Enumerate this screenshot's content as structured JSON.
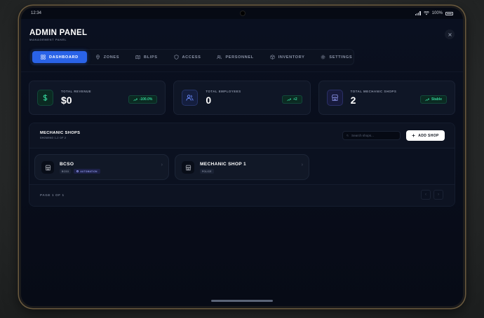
{
  "status_bar": {
    "time": "12:34",
    "battery": "100%"
  },
  "header": {
    "title": "ADMIN PANEL",
    "subtitle": "MANAGEMENT PANEL"
  },
  "nav": {
    "tabs": [
      {
        "label": "DASHBOARD",
        "icon": "dashboard-icon",
        "active": true
      },
      {
        "label": "ZONES",
        "icon": "map-pin-icon"
      },
      {
        "label": "BLIPS",
        "icon": "map-icon"
      },
      {
        "label": "ACCESS",
        "icon": "shield-icon"
      },
      {
        "label": "PERSONNEL",
        "icon": "users-icon"
      },
      {
        "label": "INVENTORY",
        "icon": "box-icon"
      },
      {
        "label": "SETTINGS",
        "icon": "gear-icon"
      }
    ]
  },
  "stats": [
    {
      "label": "TOTAL REVENUE",
      "value": "$0",
      "badge": "-100.0%",
      "icon": "dollar-icon",
      "accent": "#34d399"
    },
    {
      "label": "TOTAL EMPLOYEES",
      "value": "0",
      "badge": "+2",
      "icon": "users-icon",
      "accent": "#6b8cff"
    },
    {
      "label": "TOTAL MECHANIC SHOPS",
      "value": "2",
      "badge": "Stable",
      "icon": "store-icon",
      "accent": "#8b93e8"
    }
  ],
  "shops": {
    "title": "MECHANIC SHOPS",
    "subtitle": "SHOWING 1-2 OF 2",
    "search_placeholder": "Search shops...",
    "add_label": "ADD SHOP",
    "items": [
      {
        "name": "BCSO",
        "tags": [
          "BCSO",
          "AUTOMATION"
        ]
      },
      {
        "name": "MECHANIC SHOP 1",
        "tags": [
          "POLICE"
        ]
      }
    ],
    "page_info": "PAGE 1 OF 1"
  },
  "colors": {
    "accent": "#2a63e8",
    "positive": "#34d399",
    "background": "#060a14"
  }
}
